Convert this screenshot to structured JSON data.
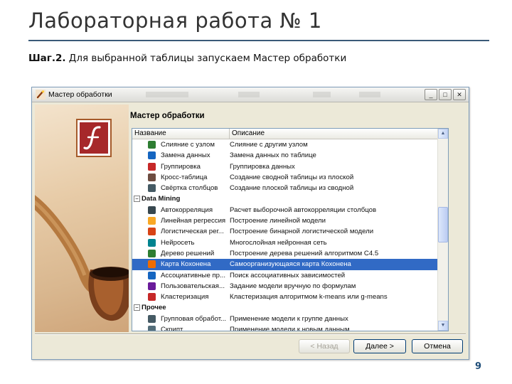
{
  "slide": {
    "title": "Лабораторная работа № 1",
    "step_label": "Шаг.2.",
    "step_text": " Для выбранной таблицы запускаем Мастер обработки",
    "page_number": "9"
  },
  "window": {
    "title": "Мастер обработки",
    "controls": {
      "minimize": "_",
      "maximize": "□",
      "close": "✕"
    },
    "panel_header": "Мастер обработки",
    "columns": {
      "name": "Название",
      "description": "Описание"
    },
    "rows": [
      {
        "type": "item",
        "name": "Слияние с узлом",
        "desc": "Слияние с другим узлом",
        "icon": "merge-icon",
        "color": "#2e7d32"
      },
      {
        "type": "item",
        "name": "Замена данных",
        "desc": "Замена данных по таблице",
        "icon": "replace-icon",
        "color": "#1565c0"
      },
      {
        "type": "item",
        "name": "Группировка",
        "desc": "Группировка данных",
        "icon": "group-icon",
        "color": "#c62828"
      },
      {
        "type": "item",
        "name": "Кросс-таблица",
        "desc": "Создание сводной таблицы из плоской",
        "icon": "crosstab-icon",
        "color": "#6d4c41"
      },
      {
        "type": "item",
        "name": "Свёртка столбцов",
        "desc": "Создание плоской таблицы из сводной",
        "icon": "fold-columns-icon",
        "color": "#455a64"
      },
      {
        "type": "group",
        "name": "Data Mining",
        "expander": "−"
      },
      {
        "type": "item",
        "name": "Автокорреляция",
        "desc": "Расчет выборочной автокорреляции столбцов",
        "icon": "autocorrelation-icon",
        "color": "#37474f"
      },
      {
        "type": "item",
        "name": "Линейная регрессия",
        "desc": "Построение линейной модели",
        "icon": "linear-regression-icon",
        "color": "#f9a825"
      },
      {
        "type": "item",
        "name": "Логистическая рег...",
        "desc": "Построение бинарной логистической модели",
        "icon": "logistic-regression-icon",
        "color": "#d84315"
      },
      {
        "type": "item",
        "name": "Нейросеть",
        "desc": "Многослойная нейронная сеть",
        "icon": "neural-net-icon",
        "color": "#00838f"
      },
      {
        "type": "item",
        "name": "Дерево решений",
        "desc": "Построение дерева решений алгоритмом C4.5",
        "icon": "decision-tree-icon",
        "color": "#2e7d32"
      },
      {
        "type": "item",
        "name": "Карта Кохонена",
        "desc": "Самоорганизующаяся карта Кохонена",
        "icon": "kohonen-map-icon",
        "color": "#ef6c00",
        "selected": true
      },
      {
        "type": "item",
        "name": "Ассоциативные пр...",
        "desc": "Поиск ассоциативных зависимостей",
        "icon": "association-rules-icon",
        "color": "#1565c0"
      },
      {
        "type": "item",
        "name": "Пользовательская...",
        "desc": "Задание модели вручную по формулам",
        "icon": "user-model-icon",
        "color": "#6a1b9a"
      },
      {
        "type": "item",
        "name": "Кластеризация",
        "desc": "Кластеризация алгоритмом k-means или g-means",
        "icon": "clustering-icon",
        "color": "#c62828"
      },
      {
        "type": "group",
        "name": "Прочее",
        "expander": "−"
      },
      {
        "type": "item",
        "name": "Групповая обработ...",
        "desc": "Применение модели к группе данных",
        "icon": "batch-processing-icon",
        "color": "#455a64"
      },
      {
        "type": "item",
        "name": "Скрипт",
        "desc": "Применение модели к новым данным",
        "icon": "script-icon",
        "color": "#546e7a"
      }
    ],
    "buttons": {
      "back": "< Назад",
      "next": "Далее >",
      "cancel": "Отмена"
    },
    "accent_color": "#316ac5"
  }
}
